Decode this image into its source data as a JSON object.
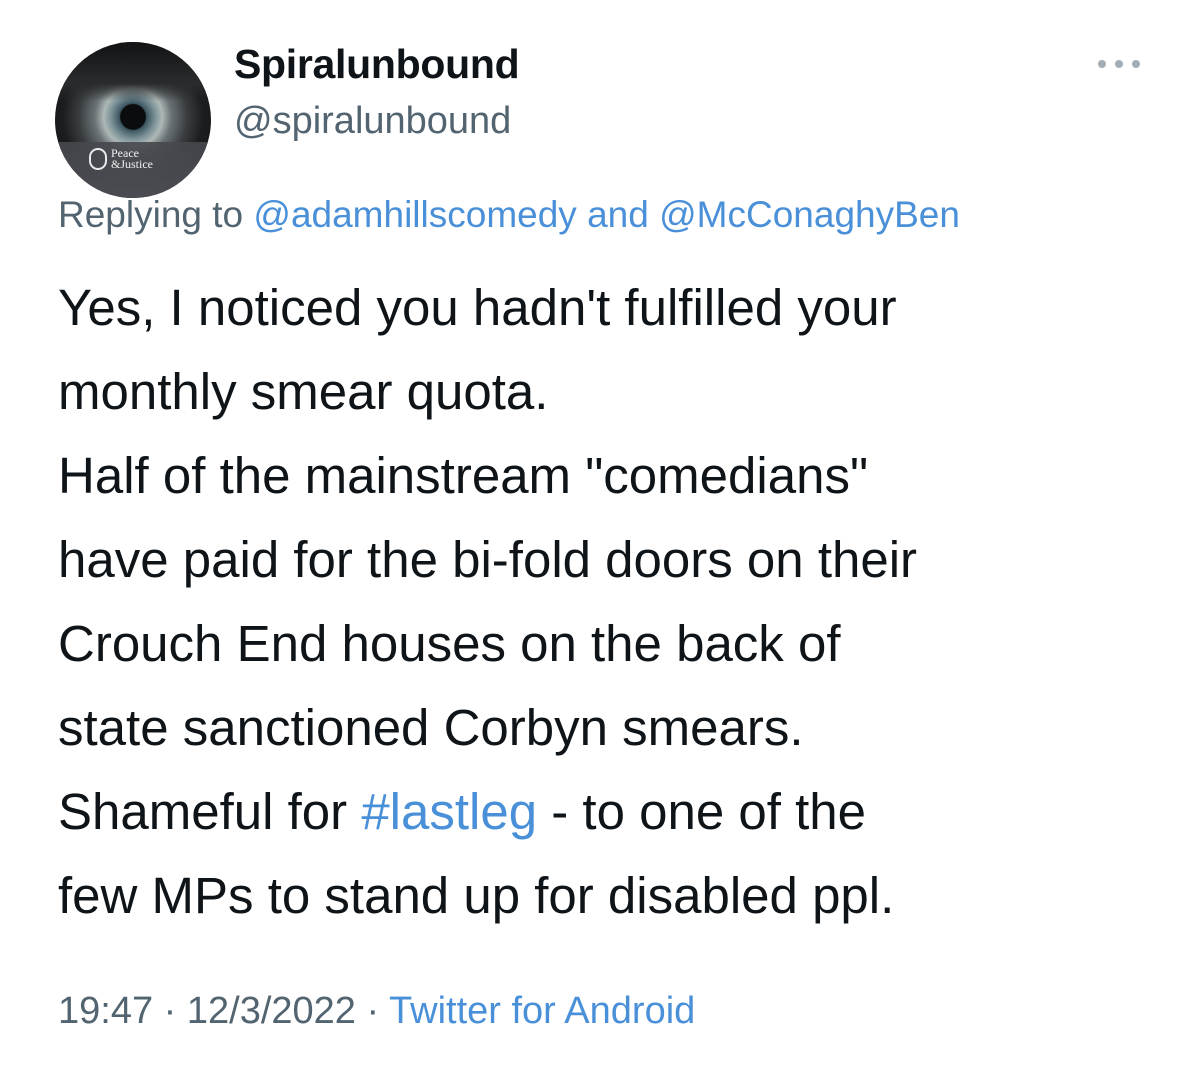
{
  "tweet": {
    "avatar_badge_text": "Peace\n&Justice",
    "display_name": "Spiralunbound",
    "handle": "@spiralunbound",
    "more_icon": "more-horizontal-icon",
    "replying_prefix": "Replying to",
    "reply_to_1": "@adamhillscomedy",
    "reply_joiner": "and",
    "reply_to_2": "@McConaghyBen",
    "body_lines": [
      "Yes, I noticed you hadn't fulfilled your",
      "monthly smear quota.",
      "Half of the mainstream \"comedians\"",
      "have paid for the bi-fold doors on their",
      "Crouch End houses on the back of",
      "state sanctioned Corbyn smears.",
      "Shameful for ",
      "#lastleg",
      " - to one of the",
      "few MPs to stand up for disabled ppl."
    ],
    "time": "19:47",
    "separator": "·",
    "date": "12/3/2022",
    "source": "Twitter for Android"
  },
  "colors": {
    "text": "#0f1419",
    "secondary": "#536471",
    "link": "#4a90d9",
    "background": "#ffffff"
  }
}
